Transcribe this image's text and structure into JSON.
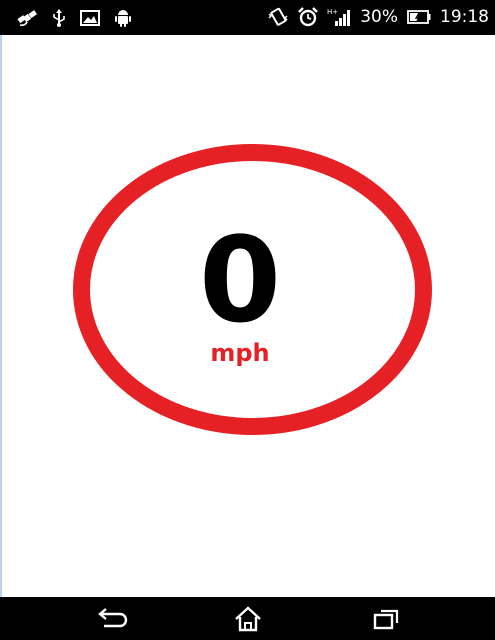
{
  "status_bar": {
    "left_icons": [
      "satellite-icon",
      "usb-icon",
      "image-icon",
      "android-icon"
    ],
    "right_icons": [
      "vibrate-icon",
      "alarm-icon",
      "signal-icon",
      "battery-icon"
    ],
    "battery_percent": "30%",
    "time": "19:18"
  },
  "speedometer": {
    "value": "0",
    "unit": "mph",
    "ring_color": "#e52126"
  },
  "nav_bar": {
    "buttons": [
      "back-icon",
      "home-icon",
      "recent-apps-icon"
    ]
  }
}
